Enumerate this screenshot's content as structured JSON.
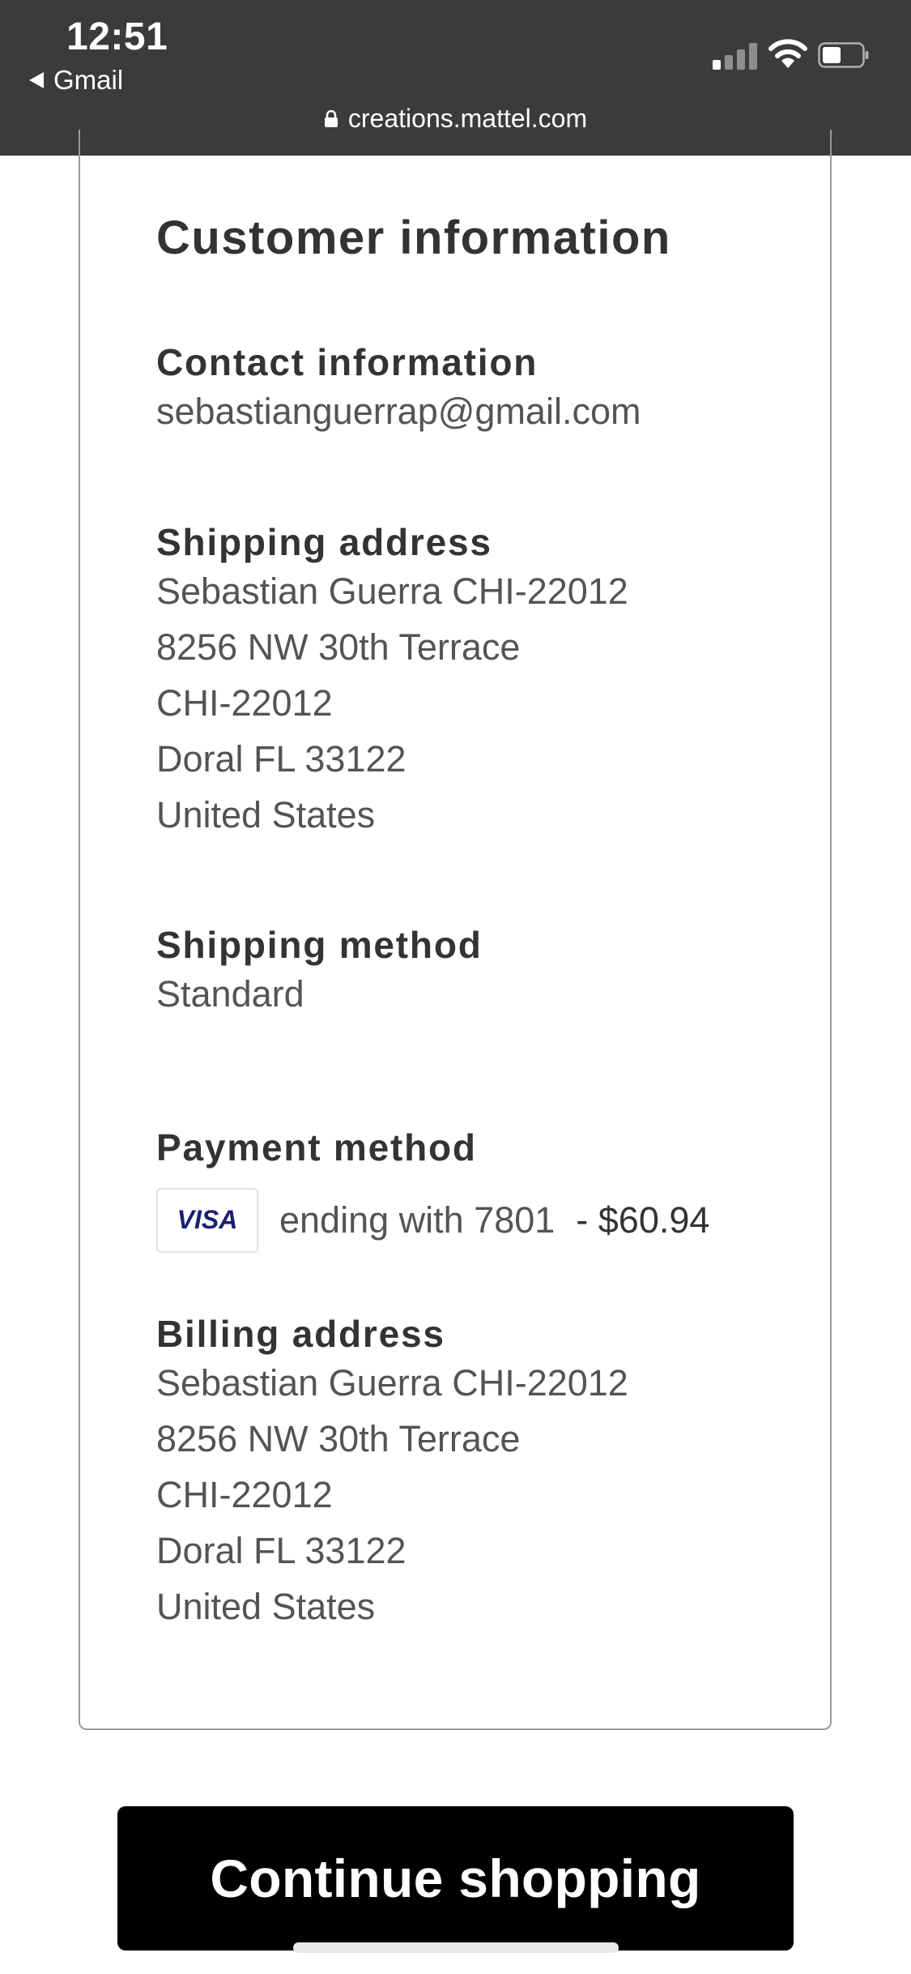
{
  "status_bar": {
    "time": "12:51",
    "back_app": "Gmail",
    "url": "creations.mattel.com"
  },
  "customer_info": {
    "title": "Customer information",
    "contact": {
      "heading": "Contact information",
      "email": "sebastianguerrap@gmail.com"
    },
    "shipping_address": {
      "heading": "Shipping address",
      "lines": [
        "Sebastian Guerra CHI-22012",
        "8256 NW 30th Terrace",
        "CHI-22012",
        "Doral FL 33122",
        "United States"
      ]
    },
    "shipping_method": {
      "heading": "Shipping method",
      "value": "Standard"
    },
    "payment_method": {
      "heading": "Payment method",
      "card_brand": "VISA",
      "ending_text": "ending with 7801",
      "amount_text": "- $60.94"
    },
    "billing_address": {
      "heading": "Billing address",
      "lines": [
        "Sebastian Guerra CHI-22012",
        "8256 NW 30th Terrace",
        "CHI-22012",
        "Doral FL 33122",
        "United States"
      ]
    }
  },
  "actions": {
    "continue_label": "Continue shopping"
  },
  "colors": {
    "status_bar_bg": "#3a3b3d",
    "heading_text": "#333333",
    "body_text": "#545454",
    "visa_blue": "#1a1f71",
    "button_bg": "#000000"
  },
  "icons": [
    "back-arrow-icon",
    "cellular-signal-icon",
    "wifi-icon",
    "battery-icon",
    "lock-icon",
    "visa-logo-icon"
  ]
}
